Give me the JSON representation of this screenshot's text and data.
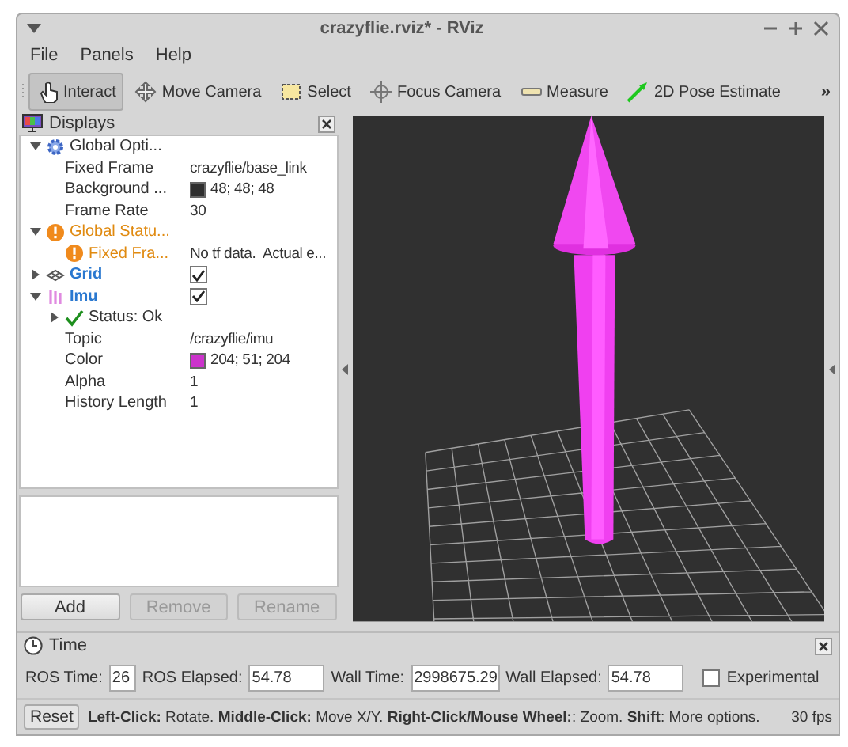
{
  "window": {
    "title": "crazyflie.rviz* - RViz"
  },
  "menu": [
    "File",
    "Panels",
    "Help"
  ],
  "toolbar": {
    "tools": [
      {
        "label": "Interact",
        "selected": true
      },
      {
        "label": "Move Camera",
        "selected": false
      },
      {
        "label": "Select",
        "selected": false
      },
      {
        "label": "Focus Camera",
        "selected": false
      },
      {
        "label": "Measure",
        "selected": false
      },
      {
        "label": "2D Pose Estimate",
        "selected": false
      }
    ],
    "overflow": "»"
  },
  "displays": {
    "title": "Displays",
    "items": [
      {
        "kind": "options",
        "label": "Global Opti...",
        "expanded": true,
        "children": [
          {
            "kind": "property",
            "label": "Fixed Frame",
            "value": "crazyflie/base_link"
          },
          {
            "kind": "property",
            "label": "Background ...",
            "value": "48; 48; 48",
            "color": "#303030"
          },
          {
            "kind": "property",
            "label": "Frame Rate",
            "value": "30"
          }
        ]
      },
      {
        "kind": "warning",
        "label": "Global Statu...",
        "expanded": true,
        "children": [
          {
            "kind": "warning",
            "label": "Fixed Fra...",
            "value": "No tf data.  Actual e..."
          }
        ]
      },
      {
        "kind": "grid",
        "label": "Grid",
        "expanded": false,
        "checked": true
      },
      {
        "kind": "imu",
        "label": "Imu",
        "expanded": true,
        "checked": true,
        "children": [
          {
            "kind": "ok",
            "label": "Status: Ok",
            "expanded": false
          },
          {
            "kind": "property",
            "label": "Topic",
            "value": "/crazyflie/imu"
          },
          {
            "kind": "property",
            "label": "Color",
            "value": "204; 51; 204",
            "color": "#cc33cc"
          },
          {
            "kind": "property",
            "label": "Alpha",
            "value": "1"
          },
          {
            "kind": "property",
            "label": "History Length",
            "value": "1"
          }
        ]
      }
    ],
    "buttons": [
      {
        "label": "Add",
        "disabled": false
      },
      {
        "label": "Remove",
        "disabled": true
      },
      {
        "label": "Rename",
        "disabled": true
      }
    ]
  },
  "time": {
    "title": "Time",
    "fields": [
      {
        "label": "ROS Time:",
        "value": "26"
      },
      {
        "label": "ROS Elapsed:",
        "value": "54.78"
      },
      {
        "label": "Wall Time:",
        "value": "2998675.29"
      },
      {
        "label": "Wall Elapsed:",
        "value": "54.78"
      }
    ],
    "experimental": {
      "label": "Experimental",
      "checked": false
    }
  },
  "status_bar": {
    "button": "Reset",
    "hint": "**Left-Click:** Rotate. **Middle-Click:** Move X/Y. **Right-Click/Mouse Wheel:**: Zoom. **Shift**: More options.",
    "fps": "30 fps"
  }
}
